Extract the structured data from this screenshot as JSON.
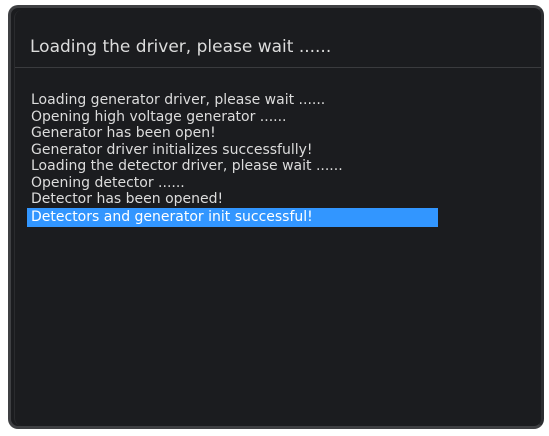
{
  "dialog": {
    "title": "Loading the driver, please wait ......"
  },
  "log": {
    "lines": [
      "Loading generator driver, please wait ......",
      "Opening high voltage generator ......",
      "Generator has been open!",
      "Generator driver initializes successfully!",
      "Loading the detector driver, please wait ......",
      "Opening detector ......",
      "Detector has been opened!",
      "Detectors and generator init successful!"
    ],
    "selected_index": 7,
    "selection_color": "#3296ff"
  },
  "colors": {
    "background": "#1b1c1f",
    "text": "#dcdcdc",
    "border": "#3f4043"
  }
}
